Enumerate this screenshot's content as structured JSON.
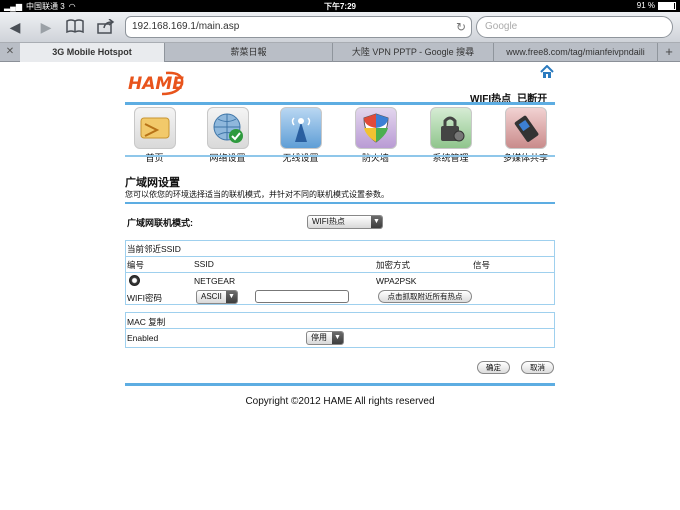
{
  "status_bar": {
    "carrier": "中国联通 3",
    "time": "下午7:29",
    "battery_text": "91 %",
    "battery_level": 0.91
  },
  "browser": {
    "url": "192.168.169.1/main.asp",
    "search_placeholder": "Google",
    "tabs": [
      {
        "label": "3G Mobile Hotspot",
        "active": true
      },
      {
        "label": "薪菜日報",
        "active": false
      },
      {
        "label": "大陸 VPN PPTP - Google 搜尋",
        "active": false
      },
      {
        "label": "www.free8.com/tag/mianfeivpndaili",
        "active": false
      }
    ]
  },
  "header": {
    "logo_text": "HAME",
    "wifi_label": "WIFI热点",
    "connection_status": "已断开"
  },
  "nav": [
    {
      "label": "首页",
      "icon": "home-card-icon"
    },
    {
      "label": "网络设置",
      "icon": "globe-check-icon"
    },
    {
      "label": "无线设置",
      "icon": "wireless-tower-icon"
    },
    {
      "label": "防火墙",
      "icon": "shield-icon"
    },
    {
      "label": "系统管理",
      "icon": "lock-gear-icon"
    },
    {
      "label": "多媒体共享",
      "icon": "usb-share-icon"
    }
  ],
  "wan": {
    "title": "广域网设置",
    "description": "您可以依您的环境选择适当的联机模式，并针对不同的联机模式设置参数。",
    "mode_label": "广域网联机模式:",
    "mode_value": "WIFI热点"
  },
  "ssid_table": {
    "caption": "当前邻近SSID",
    "headers": [
      "编号",
      "SSID",
      "加密方式",
      "信号"
    ],
    "rows": [
      {
        "ssid": "NETGEAR",
        "encryption": "WPA2PSK",
        "signal": ""
      }
    ],
    "password_label": "WIFI密码",
    "encoding_value": "ASCII",
    "password_value": "",
    "scan_button": "点击抓取附近所有热点"
  },
  "mac": {
    "caption": "MAC 复制",
    "label": "Enabled",
    "value": "停用"
  },
  "actions": {
    "ok": "确定",
    "cancel": "取消"
  },
  "footer": {
    "copyright": "Copyright ©2012 HAME All rights reserved"
  },
  "colors": {
    "accent": "#5dade2",
    "table_border": "#9fd0ee",
    "logo": "#e8541c"
  }
}
